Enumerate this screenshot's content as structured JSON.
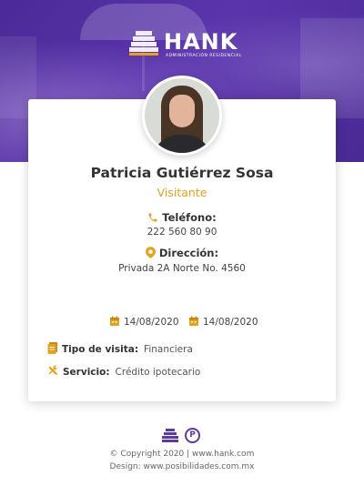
{
  "brand": {
    "name": "HANK",
    "tagline": "ADMINISTRACIÓN RESIDENCIAL",
    "purple": "#4b2a96",
    "accent": "#e6a11d"
  },
  "profile": {
    "name": "Patricia Gutiérrez Sosa",
    "role": "Visitante",
    "phone_label": "Teléfono:",
    "phone": "222 560 80 90",
    "address_label": "Dirección:",
    "address": "Privada 2A Norte No. 4560"
  },
  "visit": {
    "date_from": "14/08/2020",
    "date_to": "14/08/2020",
    "type_label": "Tipo de visita:",
    "type_value": "Financiera",
    "service_label": "Servicio:",
    "service_value": "Crédito ipotecario"
  },
  "icons": {
    "phone": "phone-icon",
    "location": "location-pin-icon",
    "calendar": "calendar-icon",
    "visit_type": "document-icon",
    "service": "tools-icon"
  },
  "footer": {
    "copyright": "© Copyright 2020 | www.hank.com",
    "design": "Design: www.posibilidades.com.mx"
  }
}
